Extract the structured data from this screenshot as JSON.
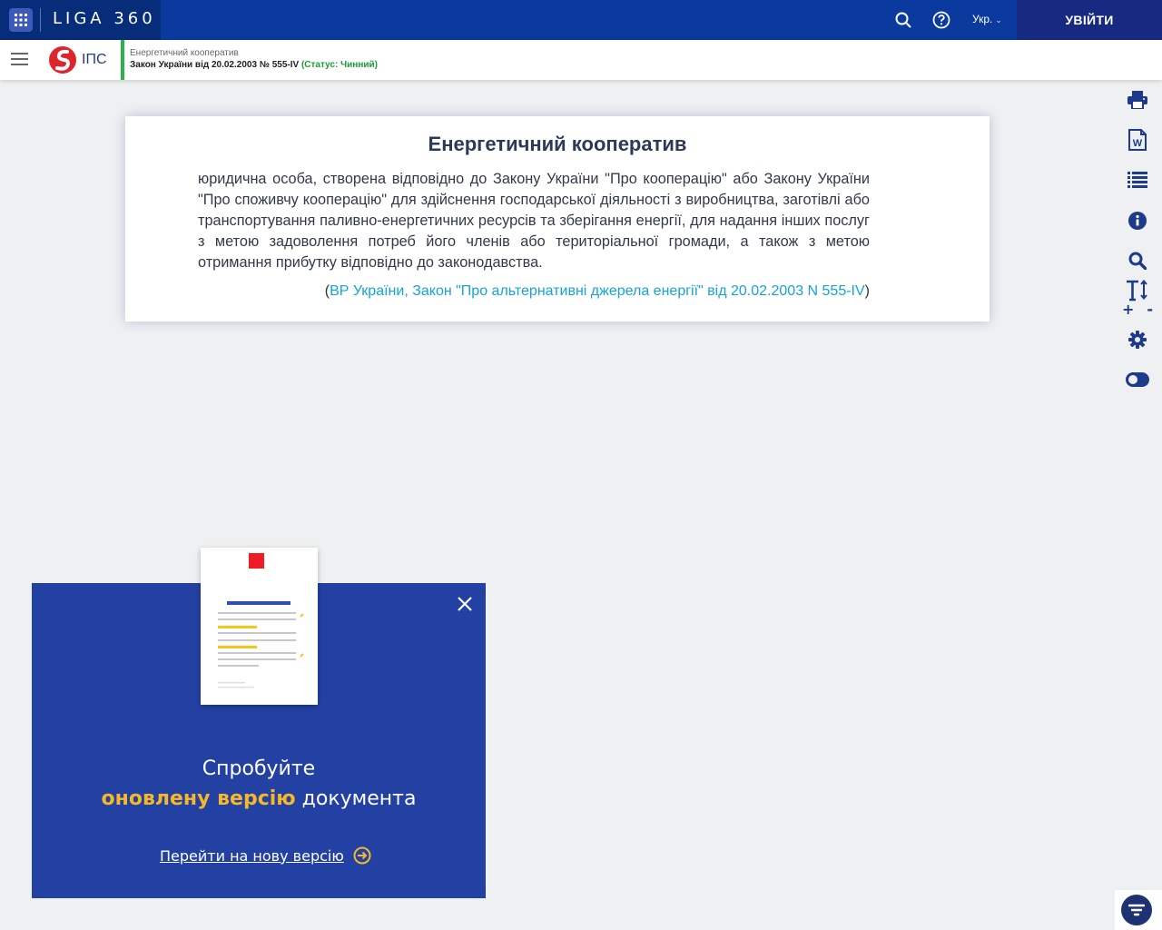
{
  "topbar": {
    "brand": "LIGA 360",
    "language": "Укр.",
    "login_label": "УВІЙТИ",
    "icons": [
      "apps-grid-icon",
      "search-icon",
      "help-icon",
      "chevron-down-icon"
    ]
  },
  "subbar": {
    "product": "ІПС",
    "doc_subtitle": "Енергетичний кооператив",
    "doc_title": "Закон України від 20.02.2003 № 555-IV ",
    "doc_status": "(Статус: Чинний)"
  },
  "article": {
    "title": "Енергетичний кооператив",
    "body": "юридична особа, створена відповідно до Закону України \"Про кооперацію\" або Закону України \"Про споживчу кооперацію\" для здійснення господарської діяльності з виробництва, заготівлі або транспортування паливно-енергетичних ресурсів та зберігання енергії, для надання інших послуг з метою задоволення потреб його членів або територіальної громади, а також з метою отримання прибутку відповідно до законодавства.",
    "source_open": "(",
    "source_link": "ВР України, Закон \"Про альтернативні джерела енергії\" від 20.02.2003 N 555-IV",
    "source_close": ")"
  },
  "right_toolbar": {
    "items": [
      "print-icon",
      "word-export-icon",
      "contents-list-icon",
      "info-icon",
      "search-icon",
      "font-size-icon",
      "settings-icon",
      "toggle-icon"
    ],
    "font_plus": "+",
    "font_minus": "-"
  },
  "promo": {
    "line1": "Спробуйте",
    "highlight": "оновлену версію",
    "line2_rest": " документа",
    "link": "Перейти на нову версію"
  },
  "colors": {
    "topbar": "#0a3a9e",
    "brand_bg": "#062c7a",
    "login_bg": "#162a82",
    "status_green": "#1e9c3a",
    "link_blue": "#15a3dc",
    "promo_bg": "#2340a3",
    "promo_accent": "#f5b82a"
  }
}
